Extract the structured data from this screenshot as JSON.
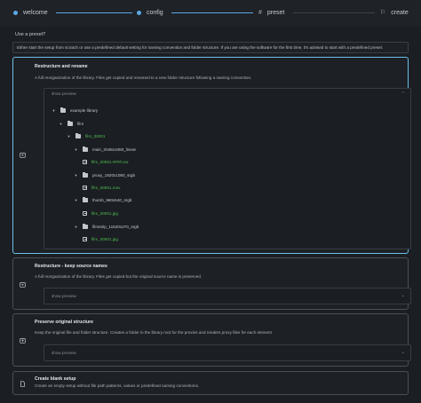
{
  "stepper": {
    "steps": [
      {
        "label": "welcome",
        "icon": "check-circle-icon"
      },
      {
        "label": "config",
        "icon": "check-circle-icon"
      },
      {
        "label": "preset",
        "icon": "hash-icon"
      },
      {
        "label": "create",
        "icon": "flag-icon"
      }
    ],
    "accent": "#5aa8e6"
  },
  "question": "Use a preset?",
  "intro": "Either start the setup from scratch or use a predefined default setting for naming convention and folder structure. If you are using the software for the first time, it's advised to start with a predefined preset.",
  "presets": [
    {
      "title": "Restructure and rename",
      "description": "A full reorganization of the library. Files get copied and renamed to a new folder structure following a naming convention.",
      "preview_label": "show preview",
      "tree": [
        {
          "label": "example library",
          "kind": "folder",
          "highlight": false
        },
        {
          "label": "film",
          "kind": "folder",
          "highlight": false
        },
        {
          "label": "film_00001",
          "kind": "folder",
          "highlight": true
        },
        {
          "label": "main_2048x1080_linear",
          "kind": "folder",
          "highlight": false
        },
        {
          "label": "film_00001.####.exr",
          "kind": "file",
          "highlight": true
        },
        {
          "label": "proxy_1920x1080_srgb",
          "kind": "folder",
          "highlight": false
        },
        {
          "label": "film_00001.mov",
          "kind": "file",
          "highlight": true
        },
        {
          "label": "thumb_960x540_srgb",
          "kind": "folder",
          "highlight": false
        },
        {
          "label": "film_00001.jpg",
          "kind": "file",
          "highlight": true
        },
        {
          "label": "filmstrip_11520x270_srgb",
          "kind": "folder",
          "highlight": false
        },
        {
          "label": "film_00001.jpg",
          "kind": "file",
          "highlight": true
        }
      ]
    },
    {
      "title": "Restructure - keep source names",
      "description": "A full reorganization of the library. Files get copied but the original source name is preserved.",
      "preview_label": "show preview"
    },
    {
      "title": "Preserve original structure",
      "description": "Keep the original file and folder structure. Creates a folder in the library root for the proxies and renders proxy files for each element.",
      "preview_label": "show preview"
    },
    {
      "title": "Create blank setup",
      "description": "Create an empty setup without file path patterns, values or predefined naming conventions."
    }
  ],
  "colors": {
    "selected_border": "#6cbfe8",
    "highlight_text": "#4fbf4f"
  }
}
